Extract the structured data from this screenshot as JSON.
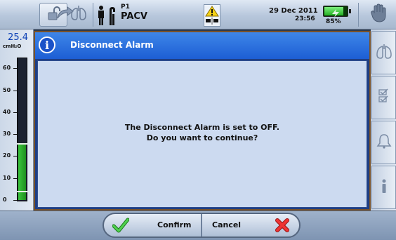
{
  "topbar": {
    "mode_profile": "P1",
    "mode_name": "PACV",
    "date": "29 Dec 2011",
    "time": "23:56",
    "battery_percent": "85%",
    "battery_level": 0.85
  },
  "gauge": {
    "value": "25.4",
    "unit": "cmH₂O",
    "ticks": [
      "60",
      "50",
      "40",
      "30",
      "20",
      "10",
      "0"
    ],
    "fill_level": 25.4
  },
  "dialog": {
    "title": "Disconnect Alarm",
    "message_line1": "The Disconnect Alarm is set to OFF.",
    "message_line2": "Do you want to continue?",
    "confirm_label": "Confirm",
    "cancel_label": "Cancel"
  },
  "icons": {
    "lock": "unlock-icon",
    "breath": "manual-breath-icon",
    "patient": "patient-icon",
    "alarm_status": "alarm-warning-icon",
    "hand": "alarm-pause-hand-icon",
    "lungs": "lungs-icon",
    "checklist": "checklist-icon",
    "bell": "alarm-bell-icon",
    "info": "info-icon",
    "confirm": "green-check-icon",
    "cancel": "red-x-icon"
  },
  "colors": {
    "accent": "#1d5ed4",
    "gauge_fill": "#2fb02f",
    "confirm": "#2fb82f",
    "cancel": "#e02828",
    "pressure_value": "#0b3fb5"
  }
}
